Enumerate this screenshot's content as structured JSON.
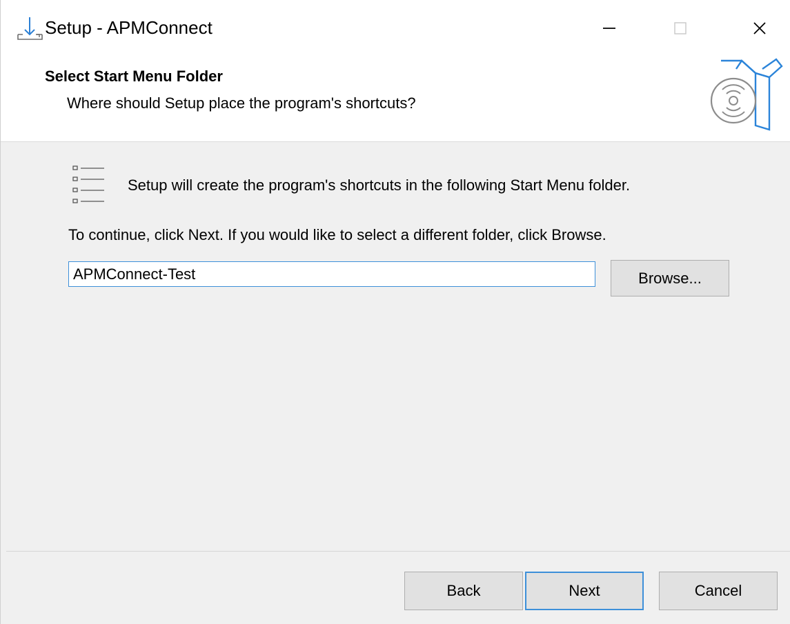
{
  "window": {
    "title": "Setup - APMConnect",
    "controls": [
      "minimize-icon",
      "maximize-icon",
      "close-icon"
    ]
  },
  "header": {
    "title": "Select Start Menu Folder",
    "subtitle": "Where should Setup place the program's shortcuts?",
    "graphic": "software-box-icon"
  },
  "content": {
    "info_icon": "list-icon",
    "info_text": "Setup will create the program's shortcuts in the following Start Menu folder.",
    "instruction_text": "To continue, click Next. If you would like to select a different folder, click Browse.",
    "folder_value": "APMConnect-Test",
    "browse_label": "Browse..."
  },
  "footer": {
    "back_label": "Back",
    "next_label": "Next",
    "cancel_label": "Cancel"
  },
  "colors": {
    "accent": "#3c8fd9",
    "button_bg": "#e1e1e1",
    "dialog_bg": "#f0f0f0"
  }
}
